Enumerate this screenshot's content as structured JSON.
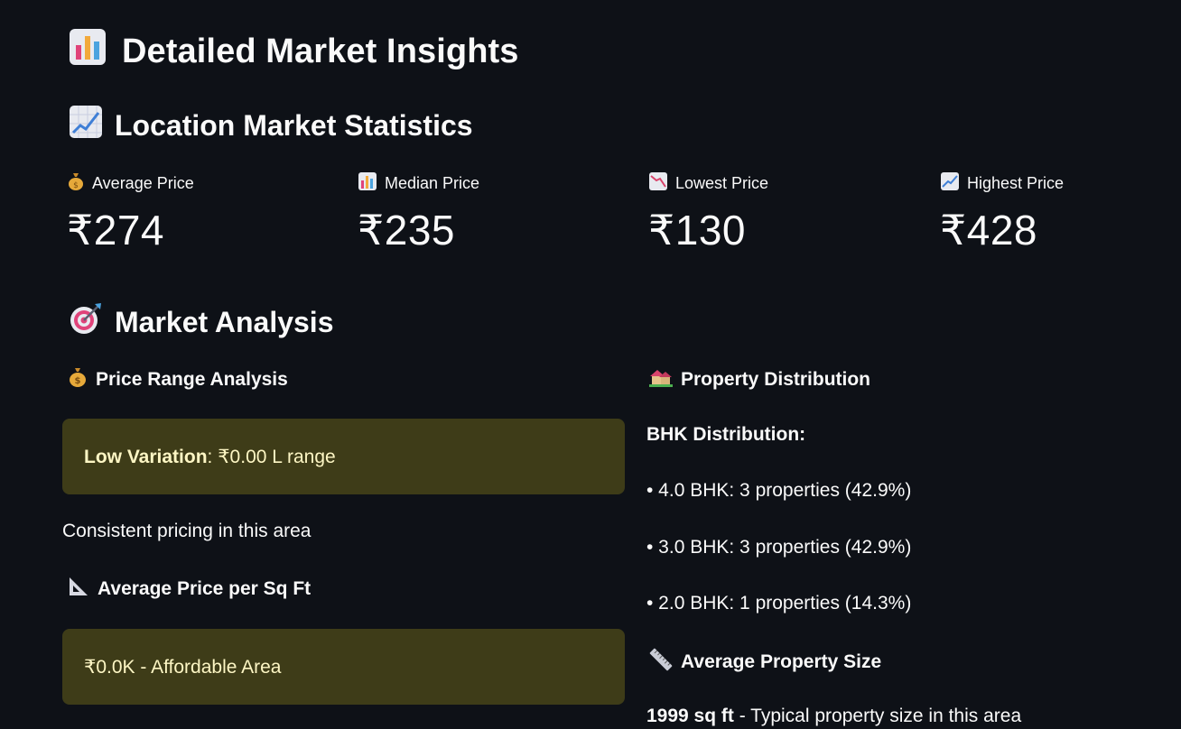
{
  "page": {
    "title": "Detailed Market Insights",
    "title_icon": "bar-chart-icon"
  },
  "stats": {
    "heading": "Location Market Statistics",
    "heading_icon": "chart-increasing-icon",
    "metrics": [
      {
        "label": "Average Price",
        "value": "₹274",
        "icon": "money-bag-icon"
      },
      {
        "label": "Median Price",
        "value": "₹235",
        "icon": "bar-chart-icon"
      },
      {
        "label": "Lowest Price",
        "value": "₹130",
        "icon": "chart-decreasing-icon"
      },
      {
        "label": "Highest Price",
        "value": "₹428",
        "icon": "chart-increasing-icon"
      }
    ]
  },
  "analysis": {
    "heading": "Market Analysis",
    "heading_icon": "target-icon",
    "price_range": {
      "heading": "Price Range Analysis",
      "box_bold": "Low Variation",
      "box_rest": ": ₹0.00 L range",
      "note": "Consistent pricing in this area"
    },
    "price_sqft": {
      "heading": "Average Price per Sq Ft",
      "box_text": "₹0.0K - Affordable Area"
    },
    "distribution": {
      "heading": "Property Distribution",
      "bhk_title": "BHK Distribution:",
      "items": [
        "• 4.0 BHK: 3 properties (42.9%)",
        "• 3.0 BHK: 3 properties (42.9%)",
        "• 2.0 BHK: 1 properties (14.3%)"
      ]
    },
    "size": {
      "heading": "Average Property Size",
      "value_bold": "1999 sq ft",
      "value_rest": " - Typical property size in this area"
    }
  },
  "colors": {
    "background": "#0e1117",
    "warning_box": "#3e3c18",
    "warning_text": "#fdf6c4"
  }
}
